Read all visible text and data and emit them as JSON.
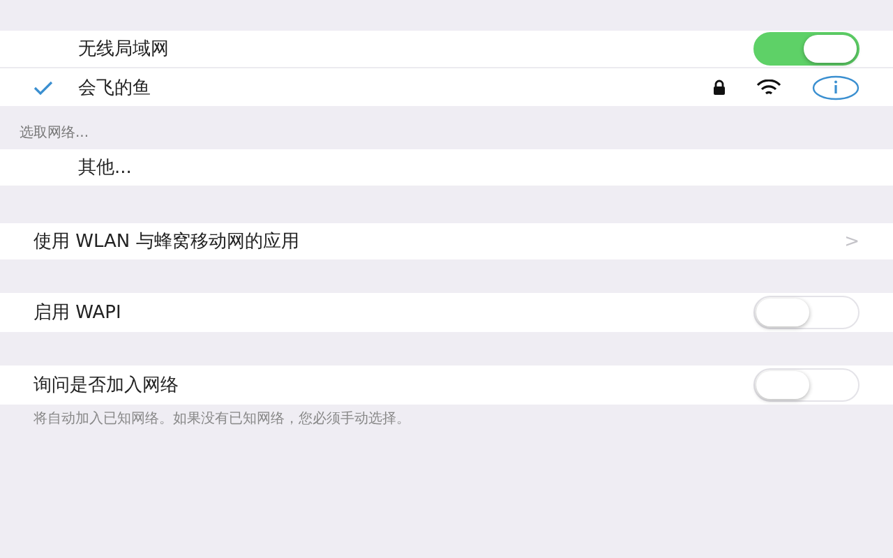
{
  "wlan": {
    "label": "无线局域网",
    "on": true
  },
  "current_network": {
    "name": "会飞的鱼",
    "connected": true,
    "locked": true
  },
  "choose_header": "选取网络...",
  "other_network": "其他...",
  "apps_row": {
    "label": "使用 WLAN 与蜂窝移动网的应用",
    "chevron": ">"
  },
  "wapi": {
    "label": "启用 WAPI",
    "on": false
  },
  "ask_to_join": {
    "label": "询问是否加入网络",
    "on": false,
    "footer": "将自动加入已知网络。如果没有已知网络，您必须手动选择。"
  }
}
